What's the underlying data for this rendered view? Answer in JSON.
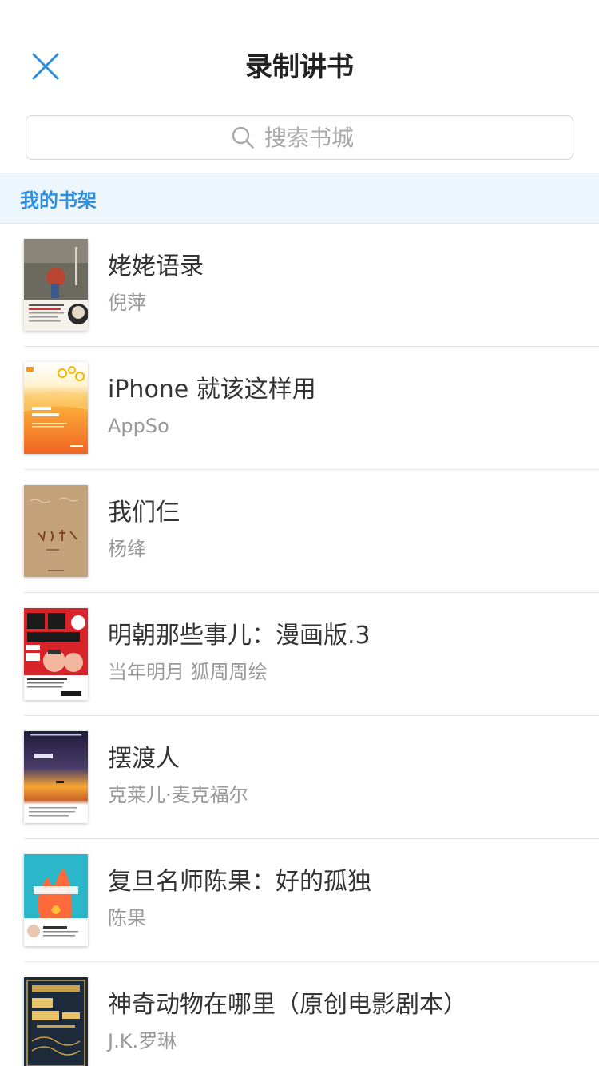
{
  "nav": {
    "title": "录制讲书",
    "close_icon": "close-icon"
  },
  "search": {
    "placeholder": "搜索书城",
    "value": ""
  },
  "shelf": {
    "header": "我的书架"
  },
  "books": [
    {
      "title": "姥姥语录",
      "author": "倪萍",
      "cover_color": "#6d6a60"
    },
    {
      "title": "iPhone 就该这样用",
      "author": "AppSo",
      "cover_color": "#f7941d"
    },
    {
      "title": "我们仨",
      "author": "杨绛",
      "cover_color": "#c9a77e"
    },
    {
      "title": "明朝那些事儿：漫画版.3",
      "author": "当年明月 狐周周绘",
      "cover_color": "#d8232a"
    },
    {
      "title": "摆渡人",
      "author": "克莱儿·麦克福尔",
      "cover_color": "#2c2a4a"
    },
    {
      "title": "复旦名师陈果：好的孤独",
      "author": "陈果",
      "cover_color": "#2ab7c9"
    },
    {
      "title": "神奇动物在哪里（原创电影剧本）",
      "author": "J.K.罗琳",
      "cover_color": "#1d2a3a"
    }
  ],
  "colors": {
    "accent": "#2d8fe0",
    "section_bg": "#eef6fd"
  }
}
